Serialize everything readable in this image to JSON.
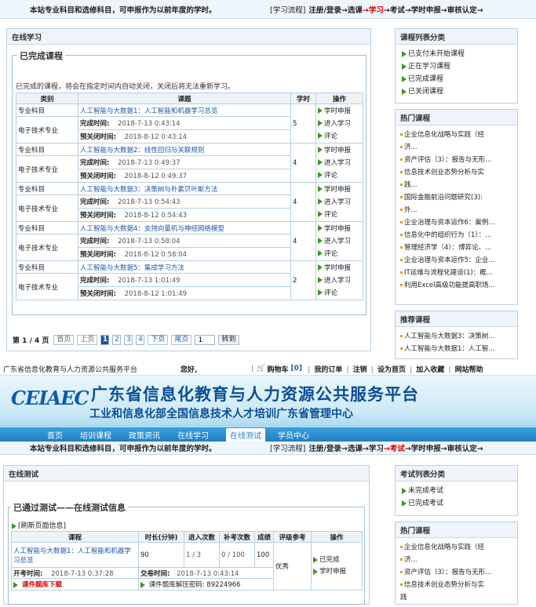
{
  "notice1": {
    "text": "本站专业科目和选修科目，可申报作为以前年度的学时。",
    "flow": [
      {
        "t": "[学习流程]",
        "c": ""
      },
      {
        "t": "注册/登录",
        "c": "b"
      },
      {
        "t": "→选课",
        "c": "b"
      },
      {
        "t": "→学习",
        "c": "r"
      },
      {
        "t": "→考试",
        "c": "b"
      },
      {
        "t": "→学时申报",
        "c": "b"
      },
      {
        "t": "→审核认定→",
        "c": "b"
      }
    ]
  },
  "study": {
    "panel_title": "在线学习",
    "legend": "已完成课程",
    "note": "已完成的课程，将会在指定时间内自动关闭，关闭后将无法重新学习。",
    "headers": [
      "类别",
      "课题",
      "学时",
      "操作"
    ],
    "courses": [
      {
        "cat1": "专业科目",
        "cat2": "电子技术专业",
        "title": "人工智能与大数据1：人工智能和机器学习总览",
        "done_label": "完成时间:",
        "done": "2018-7-13 0:43:14",
        "close_label": "预关闭时间:",
        "close": "2018-8-12 0:43:14",
        "hours": "5",
        "ops": [
          "学时申报",
          "进入学习",
          "评论"
        ]
      },
      {
        "cat1": "专业科目",
        "cat2": "电子技术专业",
        "title": "人工智能与大数据2：线性回归与关联规则",
        "done_label": "完成时间:",
        "done": "2018-7-13 0:49:37",
        "close_label": "预关闭时间:",
        "close": "2018-8-12 0:49:37",
        "hours": "4",
        "ops": [
          "学时申报",
          "进入学习",
          "评论"
        ]
      },
      {
        "cat1": "专业科目",
        "cat2": "电子技术专业",
        "title": "人工智能与大数据3：决策树与朴素贝叶斯方法",
        "done_label": "完成时间:",
        "done": "2018-7-13 0:54:43",
        "close_label": "预关闭时间:",
        "close": "2018-8-12 0:54:43",
        "hours": "4",
        "ops": [
          "学时申报",
          "进入学习",
          "评论"
        ]
      },
      {
        "cat1": "专业科目",
        "cat2": "电子技术专业",
        "title": "人工智能与大数据4：支持向量机与神经网络模型",
        "done_label": "完成时间:",
        "done": "2018-7-13 0:58:04",
        "close_label": "预关闭时间:",
        "close": "2018-8-12 0:58:04",
        "hours": "4",
        "ops": [
          "学时申报",
          "进入学习",
          "评论"
        ]
      },
      {
        "cat1": "专业科目",
        "cat2": "电子技术专业",
        "title": "人工智能与大数据5：集成学习方法",
        "done_label": "完成时间:",
        "done": "2018-7-13 1:01:49",
        "close_label": "预关闭时间:",
        "close": "2018-8-12 1:01:49",
        "hours": "2",
        "ops": [
          "学时申报",
          "进入学习",
          "评论"
        ]
      }
    ],
    "pager": {
      "info_prefix": "第",
      "cur": "1",
      "sep": "/",
      "total": "4",
      "info_suffix": "页",
      "first": "首页",
      "prev": "上页",
      "pages": [
        "1",
        "2",
        "3",
        "4"
      ],
      "next": "下页",
      "last": "尾页",
      "input": "1",
      "go": "转到"
    }
  },
  "side1": {
    "list_title": "课程列表分类",
    "list": [
      "已支付未开始课程",
      "正在学习课程",
      "已完成课程",
      "已关闭课程"
    ],
    "hot_title": "热门课程",
    "hot": [
      "企业信息化战略与实践（经",
      "济...",
      "资产评估（3）：报告与无形...",
      "信息技术创业态势分析与实",
      "践...",
      "国际金融前沿问题研究(3):",
      "外...",
      "企业治理与资本运作6：案例...",
      "信息化中的组织行为（1）：...",
      "管理经济学（4）：博弈论、...",
      "企业治理与资本运作5：企业...",
      "IT运维与流程化建设(1)：概...",
      "利用Excel高级功能提高职场..."
    ],
    "rec_title": "推荐课程",
    "rec": [
      "人工智能与大数据3：决策树...",
      "人工智能与大数据1：人工智..."
    ]
  },
  "topbar": {
    "org": "广东省信息化教育与人力资源公共服务平台",
    "hello": "您好,",
    "cart": "购物车",
    "cart_count": "[0]",
    "links": [
      "我的订单",
      "注销",
      "设为首页",
      "加入收藏",
      "网站帮助"
    ]
  },
  "banner": {
    "logo": "CEIAEC",
    "title": "广东省信息化教育与人力资源公共服务平台",
    "subtitle": "工业和信息化部全国信息技术人才培训广东省管理中心"
  },
  "nav": [
    "首页",
    "培训课程",
    "政策资讯",
    "在线学习",
    "在线测试",
    "学员中心"
  ],
  "nav_active": "在线测试",
  "notice2": {
    "text": "本站专业科目和选修科目，可申报作为以前年度的学时。",
    "flow": [
      {
        "t": "[学习流程]",
        "c": ""
      },
      {
        "t": "注册/登录",
        "c": "b"
      },
      {
        "t": "→选课",
        "c": "b"
      },
      {
        "t": "→学习",
        "c": "b"
      },
      {
        "t": "→考试",
        "c": "r"
      },
      {
        "t": "→学时申报",
        "c": "b"
      },
      {
        "t": "→审核认定→",
        "c": "b"
      }
    ]
  },
  "test": {
    "panel_title": "在线测试",
    "legend": "已通过测试——在线测试信息",
    "refresh": "[刷新页面信息]",
    "headers": [
      "课程",
      "时长(分钟)",
      "进入次数",
      "补考次数",
      "成绩",
      "评级参考",
      "操作"
    ],
    "row": {
      "title": "人工智能与大数据1：人工智能和机器学习总览",
      "duration": "90",
      "enter": "1 / 3",
      "retake": "0 / 100",
      "score": "100",
      "grade": "优秀",
      "ops": [
        "已完成",
        "学时申报"
      ],
      "open_label": "开考时间:",
      "open": "2018-7-13 0:37:28",
      "submit_label": "交卷时间:",
      "submit": "2018-7-13 0:43:14",
      "download": "课件题库下载",
      "pwd_label": "课件题库解压密码:",
      "pwd": "89224966"
    }
  },
  "side2": {
    "list_title": "考试列表分类",
    "list": [
      "未完成考试",
      "已完成考试"
    ],
    "hot_title": "热门课程",
    "hot": [
      "企业信息化战略与实践（经",
      "济...",
      "资产评估（3）：报告与无形...",
      "信息技术创业态势分析与实",
      "践"
    ]
  }
}
